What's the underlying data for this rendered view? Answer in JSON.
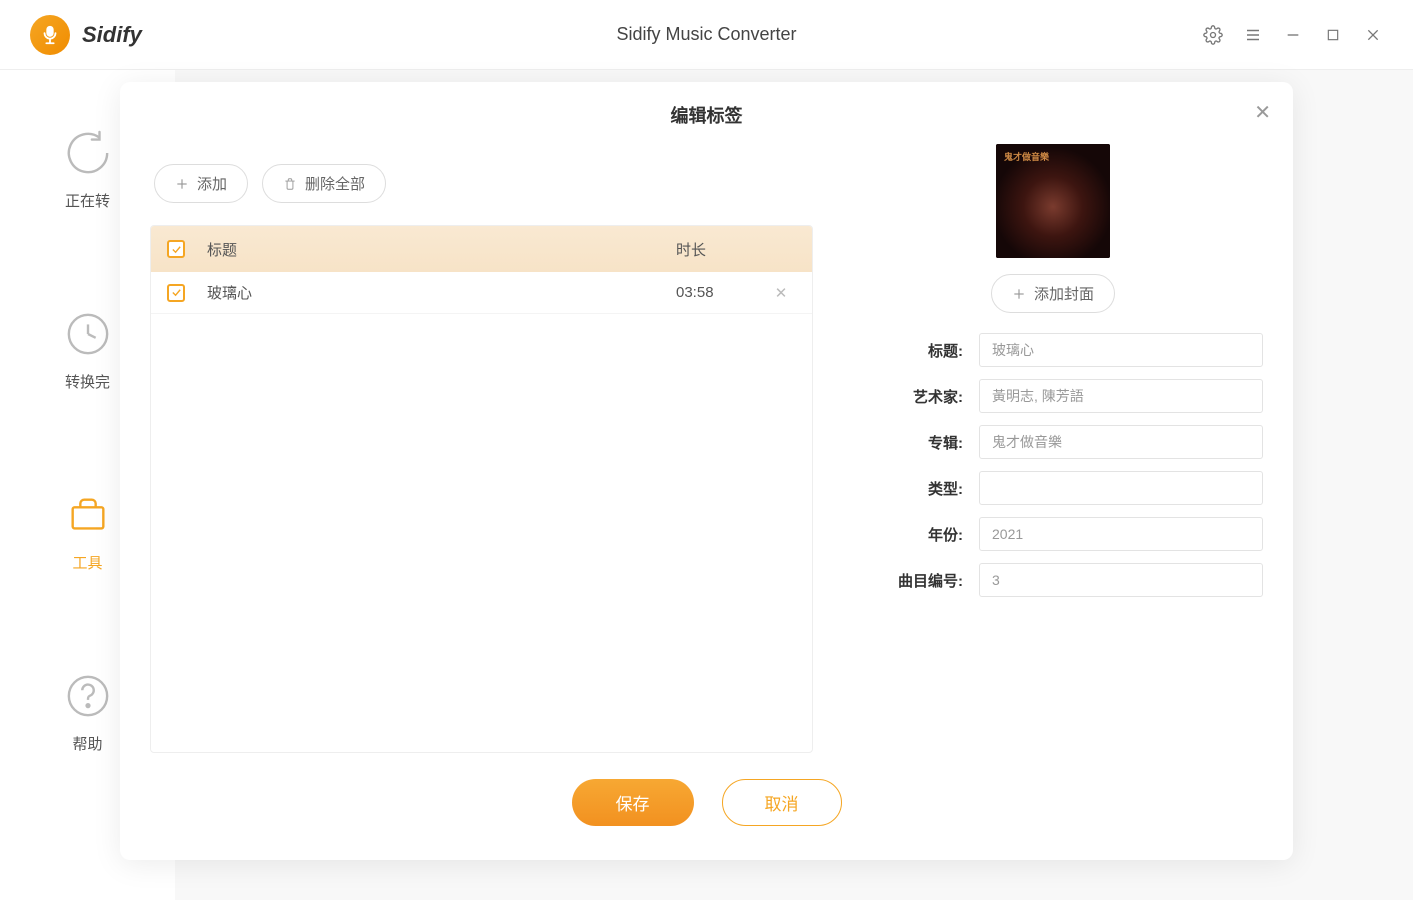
{
  "titlebar": {
    "app_name": "Sidify",
    "app_title": "Sidify Music Converter"
  },
  "sidebar": {
    "items": [
      {
        "label": "正在转"
      },
      {
        "label": "转换完"
      },
      {
        "label": "工具"
      },
      {
        "label": "帮助"
      }
    ]
  },
  "modal": {
    "title": "编辑标签",
    "add_btn": "添加",
    "delete_all_btn": "删除全部",
    "add_cover_btn": "添加封面",
    "save_btn": "保存",
    "cancel_btn": "取消"
  },
  "table": {
    "col_title": "标题",
    "col_duration": "时长",
    "rows": [
      {
        "title": "玻璃心",
        "duration": "03:58"
      }
    ]
  },
  "form": {
    "labels": {
      "title": "标题:",
      "artist": "艺术家:",
      "album": "专辑:",
      "genre": "类型:",
      "year": "年份:",
      "track": "曲目编号:"
    },
    "values": {
      "title": "玻璃心",
      "artist": "黃明志, 陳芳語",
      "album": "鬼才做音樂",
      "genre": "",
      "year": "2021",
      "track": "3"
    }
  }
}
